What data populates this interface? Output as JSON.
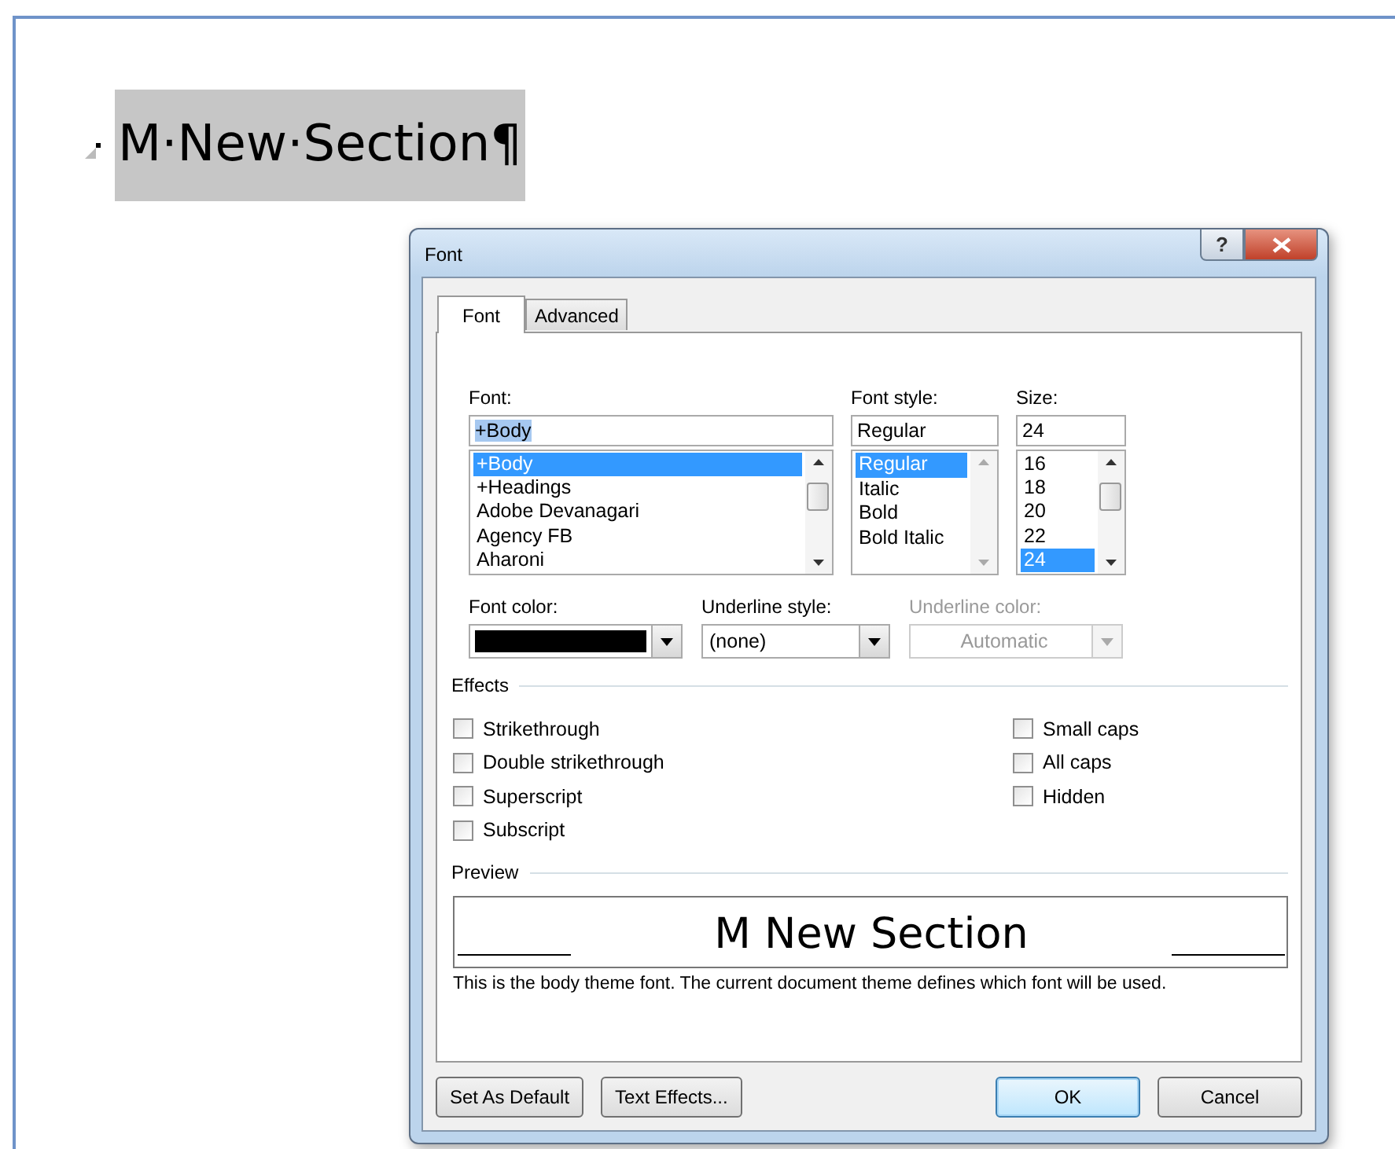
{
  "document": {
    "heading": "M·New·Section¶"
  },
  "dialog": {
    "title": "Font",
    "help_button": "?"
  },
  "tabs": [
    {
      "label": "Font",
      "selected": true
    },
    {
      "label": "Advanced",
      "selected": false
    }
  ],
  "font": {
    "label": "Font:",
    "value": "+Body",
    "items": [
      {
        "label": "+Body",
        "selected": true
      },
      {
        "label": "+Headings",
        "selected": false
      },
      {
        "label": "Adobe Devanagari",
        "selected": false
      },
      {
        "label": "Agency FB",
        "selected": false
      },
      {
        "label": "Aharoni",
        "selected": false
      }
    ]
  },
  "font_style": {
    "label": "Font style:",
    "value": "Regular",
    "items": [
      {
        "label": "Regular",
        "selected": true
      },
      {
        "label": "Italic",
        "selected": false
      },
      {
        "label": "Bold",
        "selected": false
      },
      {
        "label": "Bold Italic",
        "selected": false
      }
    ]
  },
  "size": {
    "label": "Size:",
    "value": "24",
    "items": [
      {
        "label": "16",
        "selected": false
      },
      {
        "label": "18",
        "selected": false
      },
      {
        "label": "20",
        "selected": false
      },
      {
        "label": "22",
        "selected": false
      },
      {
        "label": "24",
        "selected": true
      }
    ]
  },
  "font_color": {
    "label": "Font color:"
  },
  "underline_style": {
    "label": "Underline style:",
    "value": "(none)",
    "disabled": false
  },
  "underline_color": {
    "label": "Underline color:",
    "value": "Automatic",
    "disabled": true
  },
  "effects": {
    "heading": "Effects",
    "left": [
      {
        "label": "Strikethrough",
        "checked": false
      },
      {
        "label": "Double strikethrough",
        "checked": false
      },
      {
        "label": "Superscript",
        "checked": false
      },
      {
        "label": "Subscript",
        "checked": false
      }
    ],
    "right": [
      {
        "label": "Small caps",
        "checked": false
      },
      {
        "label": "All caps",
        "checked": false
      },
      {
        "label": "Hidden",
        "checked": false
      }
    ]
  },
  "preview": {
    "heading": "Preview",
    "sample": "M New Section",
    "note": "This is the body theme font. The current document theme defines which font will be used."
  },
  "buttons_left": [
    {
      "label": "Set As Default",
      "default": false
    },
    {
      "label": "Text Effects...",
      "default": false
    }
  ],
  "buttons_right": [
    {
      "label": "OK",
      "default": true
    },
    {
      "label": "Cancel",
      "default": false
    }
  ]
}
